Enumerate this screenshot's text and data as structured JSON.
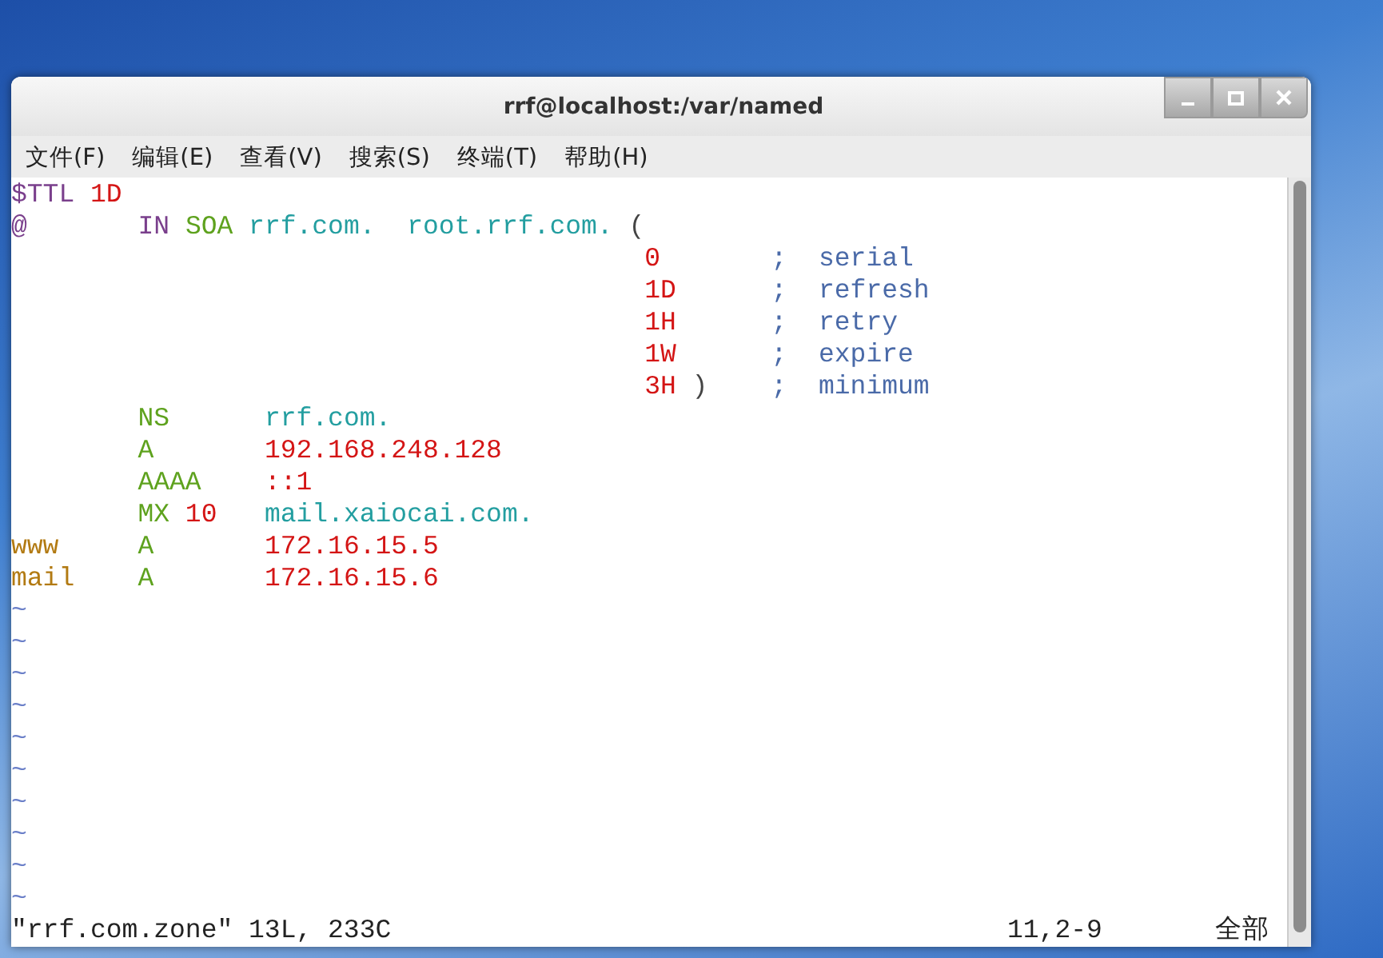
{
  "window": {
    "title": "rrf@localhost:/var/named",
    "controls": [
      {
        "kind": "minimize"
      },
      {
        "kind": "maximize"
      },
      {
        "kind": "close"
      }
    ]
  },
  "menu": [
    "文件(F)",
    "编辑(E)",
    "查看(V)",
    "搜索(S)",
    "终端(T)",
    "帮助(H)"
  ],
  "lines": [
    [
      {
        "text": "$TTL ",
        "kind": "directive"
      },
      {
        "text": "1D",
        "kind": "number"
      }
    ],
    [
      {
        "text": "@       ",
        "kind": "directive"
      },
      {
        "text": "IN ",
        "kind": "directive"
      },
      {
        "text": "SOA ",
        "kind": "type"
      },
      {
        "text": "rrf.com.  ",
        "kind": "name"
      },
      {
        "text": "root.rrf.com. ",
        "kind": "name"
      },
      {
        "text": "(",
        "kind": "paren"
      }
    ],
    [
      {
        "text": "                                        0       ",
        "kind": "number"
      },
      {
        "text": ";  serial",
        "kind": "comment"
      }
    ],
    [
      {
        "text": "                                        1D      ",
        "kind": "number"
      },
      {
        "text": ";  refresh",
        "kind": "comment"
      }
    ],
    [
      {
        "text": "                                        1H      ",
        "kind": "number"
      },
      {
        "text": ";  retry",
        "kind": "comment"
      }
    ],
    [
      {
        "text": "                                        1W      ",
        "kind": "number"
      },
      {
        "text": ";  expire",
        "kind": "comment"
      }
    ],
    [
      {
        "text": "                                        3H ",
        "kind": "number"
      },
      {
        "text": ")    ",
        "kind": "paren"
      },
      {
        "text": ";  minimum",
        "kind": "comment"
      }
    ],
    [
      {
        "text": "        NS      ",
        "kind": "type"
      },
      {
        "text": "rrf.com.",
        "kind": "name"
      }
    ],
    [
      {
        "text": "        A       ",
        "kind": "type"
      },
      {
        "text": "192.168.248.128",
        "kind": "number"
      }
    ],
    [
      {
        "text": "        AAAA    ",
        "kind": "type"
      },
      {
        "text": "::1",
        "kind": "number"
      }
    ],
    [
      {
        "text": "        MX ",
        "kind": "type"
      },
      {
        "text": "10   ",
        "kind": "number"
      },
      {
        "text": "mail.xaiocai.com.",
        "kind": "name"
      }
    ],
    [
      {
        "text": "www     ",
        "kind": "host"
      },
      {
        "text": "A       ",
        "kind": "type"
      },
      {
        "text": "172.16.15.5",
        "kind": "number"
      }
    ],
    [
      {
        "text": "mail    ",
        "kind": "host"
      },
      {
        "text": "A       ",
        "kind": "type"
      },
      {
        "text": "172.16.15.6",
        "kind": "number"
      }
    ]
  ],
  "empty_lines": [
    "~",
    "~",
    "~",
    "~",
    "~",
    "~",
    "~",
    "~",
    "~",
    "~"
  ],
  "status_bar": {
    "file_info": "\"rrf.com.zone\" 13L, 233C",
    "position": "11,2-9",
    "scroll": "全部"
  }
}
